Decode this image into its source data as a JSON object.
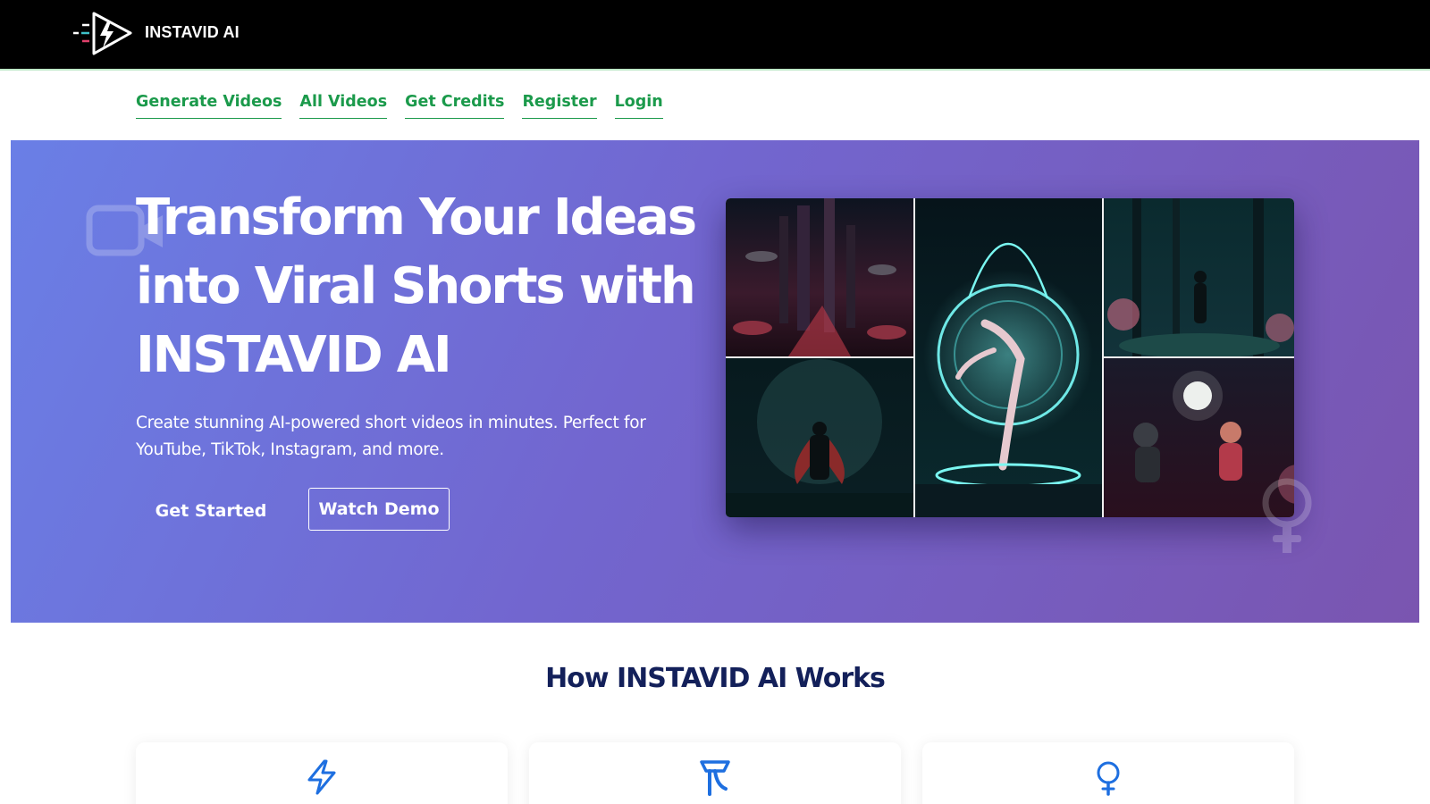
{
  "brand": {
    "name": "INSTAVID AI",
    "logo_icon": "lightning-play-icon"
  },
  "nav": {
    "items": [
      {
        "label": "Generate Videos"
      },
      {
        "label": "All Videos"
      },
      {
        "label": "Get Credits"
      },
      {
        "label": "Register"
      },
      {
        "label": "Login"
      }
    ]
  },
  "hero": {
    "title": "Transform Your Ideas into Viral Shorts with INSTAVID AI",
    "subtitle": "Create stunning AI-powered short videos in minutes. Perfect for YouTube, TikTok, Instagram, and more.",
    "primary_button": "Get Started",
    "secondary_button": "Watch Demo",
    "collage_icon": "video-collage-image"
  },
  "how": {
    "title": "How INSTAVID AI Works",
    "cards": [
      {
        "icon": "lightning-icon"
      },
      {
        "icon": "magic-wand-icon"
      },
      {
        "icon": "lightbulb-icon"
      }
    ]
  },
  "colors": {
    "topbar": "#000000",
    "nav_link": "#1b9a4b",
    "hero_start": "#6a7fe6",
    "hero_end": "#7a55b0",
    "heading": "#13205a",
    "card_icon": "#1e6fe0"
  }
}
